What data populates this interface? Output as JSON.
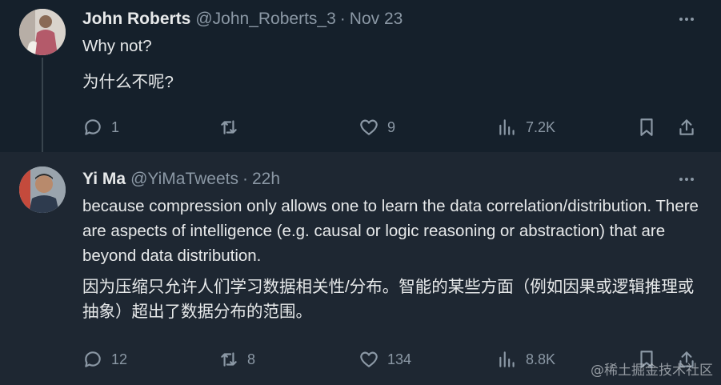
{
  "tweets": [
    {
      "name": "John Roberts",
      "handle": "@John_Roberts_3",
      "time": "Nov 23",
      "text_en": "Why not?",
      "text_zh": "为什么不呢?",
      "replies": "1",
      "retweets": "",
      "likes": "9",
      "views": "7.2K"
    },
    {
      "name": "Yi Ma",
      "handle": "@YiMaTweets",
      "time": "22h",
      "text_en": "because compression only allows one to learn the data correlation/distribution. There are aspects of intelligence (e.g. causal or logic reasoning or abstraction) that are beyond data distribution.",
      "text_zh": "因为压缩只允许人们学习数据相关性/分布。智能的某些方面（例如因果或逻辑推理或抽象）超出了数据分布的范围。",
      "replies": "12",
      "retweets": "8",
      "likes": "134",
      "views": "8.8K"
    }
  ],
  "separator": "·",
  "watermark": "@稀土掘金技术社区",
  "colors": {
    "background": "#15202b",
    "reply_background": "#1e2732",
    "text_primary": "#e7e9ea",
    "text_secondary": "#8b98a5",
    "thread_line": "#38444d"
  },
  "icons": [
    "reply-icon",
    "retweet-icon",
    "like-icon",
    "views-icon",
    "bookmark-icon",
    "share-icon",
    "more-icon"
  ]
}
